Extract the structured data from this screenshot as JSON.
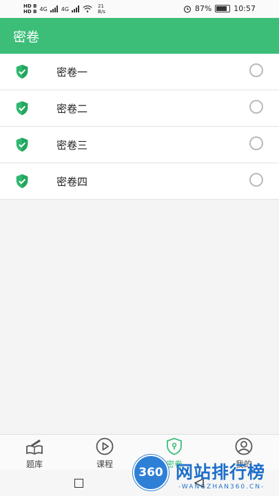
{
  "status_bar": {
    "sim1": "HD B",
    "sim2": "HD B",
    "network": "4G",
    "speed_value": "21",
    "speed_unit": "B/s",
    "battery": "87%",
    "time": "10:57"
  },
  "app_bar": {
    "title": "密卷"
  },
  "list": {
    "items": [
      {
        "label": "密卷一",
        "icon": "shield-check-icon"
      },
      {
        "label": "密卷二",
        "icon": "shield-check-icon"
      },
      {
        "label": "密卷三",
        "icon": "shield-check-icon"
      },
      {
        "label": "密卷四",
        "icon": "shield-check-icon"
      }
    ]
  },
  "bottom_nav": {
    "tabs": [
      {
        "label": "题库",
        "icon": "book-pencil-icon"
      },
      {
        "label": "课程",
        "icon": "play-circle-icon"
      },
      {
        "label": "密卷",
        "icon": "shield-keyhole-icon",
        "active": true
      },
      {
        "label": "我的",
        "icon": "user-circle-icon"
      }
    ]
  },
  "watermark": {
    "badge": "360",
    "title": "网站排行榜",
    "subtitle": "-WANGZHAN360.CN-"
  },
  "colors": {
    "brand": "#3cbe79",
    "icon_green": "#2fb870",
    "radio_border": "#b9b9b9"
  }
}
